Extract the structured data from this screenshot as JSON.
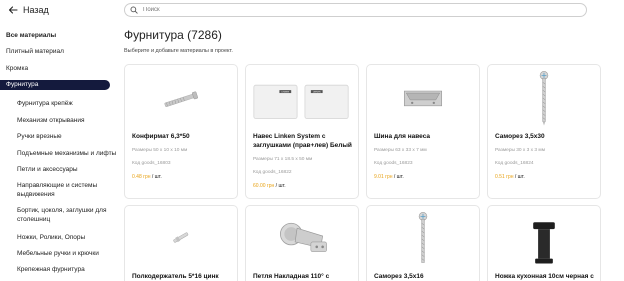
{
  "header": {
    "back_label": "Назад",
    "search_placeholder": "Поиск"
  },
  "sidebar": {
    "items": [
      {
        "label": "Все материалы"
      },
      {
        "label": "Плитный материал"
      },
      {
        "label": "Кромка"
      },
      {
        "label": "Фурнитура"
      },
      {
        "label": "Фурнитура крепёж"
      },
      {
        "label": "Механизм открывания"
      },
      {
        "label": "Ручки врезные"
      },
      {
        "label": "Подъемные механизмы и лифты"
      },
      {
        "label": "Петли и аксессуары"
      },
      {
        "label": "Направляющие и системы выдвижения"
      },
      {
        "label": "Бортик, цоколя, заглушки для столешниц"
      },
      {
        "label": "Ножки, Ролики, Опоры"
      },
      {
        "label": "Мебельные ручки и крючки"
      },
      {
        "label": "Крепежная фурнитура"
      }
    ]
  },
  "main": {
    "title": "Фурнитура (7286)",
    "subtitle": "Выберите и добавьте материалы в проект.",
    "per_unit": "/ шт.",
    "products": [
      {
        "name": "Конфирмат 6,3*50",
        "size": "Размеры 50 x 10 x 10 мм",
        "code": "Код goods_16803",
        "price": "0.48 грн"
      },
      {
        "name": "Навес Linken System с заглушками (прав+лев) Белый",
        "size": "Размеры 71 x 18.5 x 50 мм",
        "code": "Код goods_16822",
        "price": "60.00 грн",
        "logo": "LINKEN"
      },
      {
        "name": "Шина для навеса",
        "size": "Размеры 63 x 33 x 7 мм",
        "code": "Код goods_16823",
        "price": "9.01 грн"
      },
      {
        "name": "Саморез 3,5х30",
        "size": "Размеры 30 x 3 x 3 мм",
        "code": "Код goods_16824",
        "price": "0.51 грн"
      },
      {
        "name": "Полкодержатель 5*16 цинк",
        "size": "",
        "code": "",
        "price": ""
      },
      {
        "name": "Петля Накладная 110° с",
        "size": "",
        "code": "",
        "price": ""
      },
      {
        "name": "Саморез 3,5х16",
        "size": "",
        "code": "",
        "price": ""
      },
      {
        "name": "Ножка кухонная 10см черная с",
        "size": "",
        "code": "",
        "price": ""
      }
    ]
  }
}
